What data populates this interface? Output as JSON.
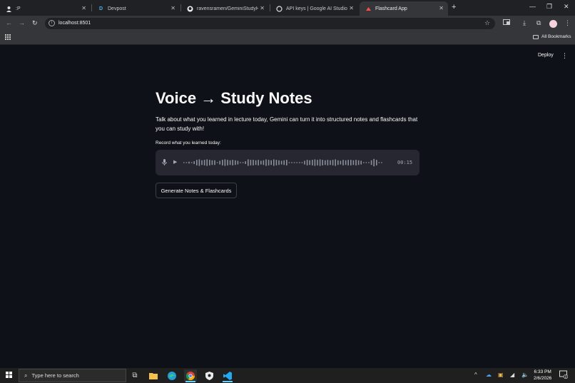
{
  "browser": {
    "tabs": [
      {
        "title": ":P",
        "icon": "person-icon",
        "active": false
      },
      {
        "title": "Devpost",
        "icon": "devpost-icon",
        "active": false
      },
      {
        "title": "ravensramen/GeminiStudyHelp",
        "icon": "github-icon",
        "active": false
      },
      {
        "title": "API keys | Google AI Studio",
        "icon": "ai-studio-icon",
        "active": false
      },
      {
        "title": "Flashcard App",
        "icon": "streamlit-icon",
        "active": true
      }
    ],
    "url": "localhost:8501",
    "bookmarks_label": "All Bookmarks"
  },
  "app": {
    "deploy_label": "Deploy",
    "title": "Voice → Study Notes",
    "description": "Talk about what you learned in lecture today, Gemini can turn it into structured notes and flashcards that you can study with!",
    "record_label": "Record what you learned today:",
    "recording_time": "00:15",
    "generate_label": "Generate Notes & Flashcards"
  },
  "taskbar": {
    "search_placeholder": "Type here to search",
    "time": "6:33 PM",
    "date": "2/6/2026",
    "notification_count": "2"
  },
  "colors": {
    "background": "#0e1117",
    "recorder_bg": "#262730",
    "text": "#fafafa",
    "muted": "#a3a8b8",
    "tab_active": "#35363a",
    "tabbar": "#202124"
  }
}
